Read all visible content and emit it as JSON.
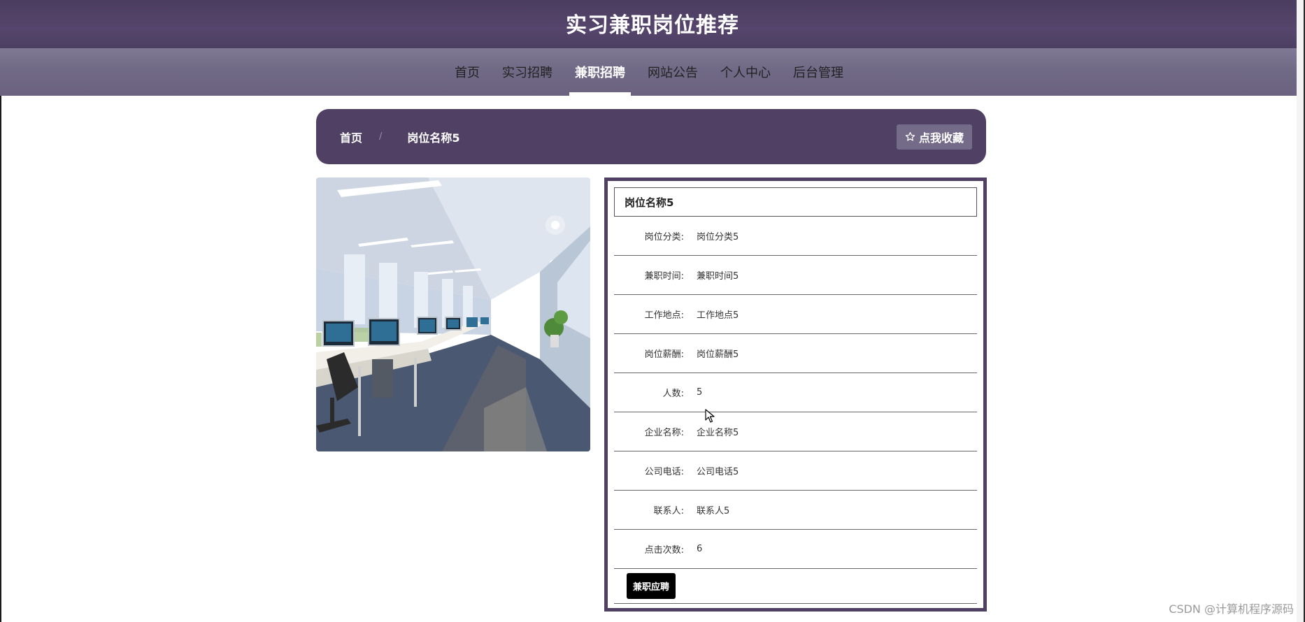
{
  "header": {
    "site_title": "实习兼职岗位推荐"
  },
  "nav": {
    "items": [
      {
        "label": "首页",
        "active": false
      },
      {
        "label": "实习招聘",
        "active": false
      },
      {
        "label": "兼职招聘",
        "active": true
      },
      {
        "label": "网站公告",
        "active": false
      },
      {
        "label": "个人中心",
        "active": false
      },
      {
        "label": "后台管理",
        "active": false
      }
    ]
  },
  "breadcrumb": {
    "home": "首页",
    "separator": "/",
    "current": "岗位名称5",
    "favorite_label": "点我收藏",
    "favorite_icon": "star-outline-icon"
  },
  "detail": {
    "title": "岗位名称5",
    "rows": [
      {
        "label": "岗位分类:",
        "value": "岗位分类5"
      },
      {
        "label": "兼职时间:",
        "value": "兼职时间5"
      },
      {
        "label": "工作地点:",
        "value": "工作地点5"
      },
      {
        "label": "岗位薪酬:",
        "value": "岗位薪酬5"
      },
      {
        "label": "人数:",
        "value": "5"
      },
      {
        "label": "企业名称:",
        "value": "企业名称5"
      },
      {
        "label": "公司电话:",
        "value": "公司电话5"
      },
      {
        "label": "联系人:",
        "value": "联系人5"
      },
      {
        "label": "点击次数:",
        "value": "6"
      }
    ],
    "apply_label": "兼职应聘"
  },
  "watermark": "CSDN @计算机程序源码",
  "colors": {
    "brand_purple": "#4f4064",
    "nav_gray": "#716a86",
    "button_black": "#000000"
  }
}
